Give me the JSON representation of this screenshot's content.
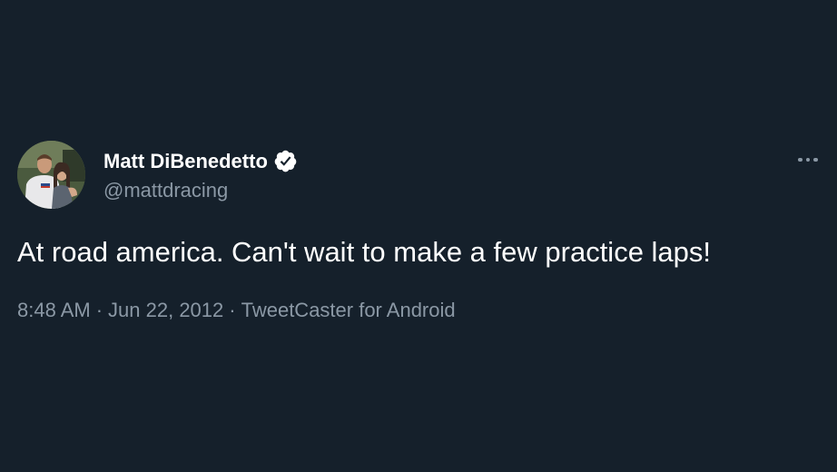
{
  "tweet": {
    "author": {
      "display_name": "Matt DiBenedetto",
      "handle": "@mattdracing",
      "verified": true,
      "avatar_icon": "profile-photo-icon"
    },
    "text": "At road america. Can't wait to make a few practice laps!",
    "meta": {
      "time": "8:48 AM",
      "date": "Jun 22, 2012",
      "source": "TweetCaster for Android",
      "separator": "·"
    },
    "more_icon": "more-options-icon"
  },
  "colors": {
    "background": "#15202b",
    "primary_text": "#ffffff",
    "secondary_text": "#8b98a5",
    "verified_badge": "#ffffff"
  }
}
